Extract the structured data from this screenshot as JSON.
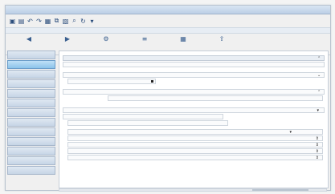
{
  "ribbon": {
    "buttons": [
      {
        "icon": "back-icon"
      },
      {
        "icon": "forward-icon"
      },
      {
        "icon": "settings-icon"
      },
      {
        "icon": "list-icon"
      },
      {
        "icon": "grid-icon"
      },
      {
        "icon": "export-icon"
      }
    ]
  },
  "sidebar": {
    "items": [
      {
        "active": false
      },
      {
        "active": true
      },
      {
        "active": false
      },
      {
        "active": false
      },
      {
        "active": false
      },
      {
        "active": false
      },
      {
        "active": false
      },
      {
        "active": false
      },
      {
        "active": false
      },
      {
        "active": false
      },
      {
        "active": false
      },
      {
        "active": false
      },
      {
        "active": false
      }
    ]
  },
  "colors": {
    "titlebar": "#bccfe6",
    "sidebar_active": "#8cc3ea",
    "panel_bg": "#ffffff"
  }
}
